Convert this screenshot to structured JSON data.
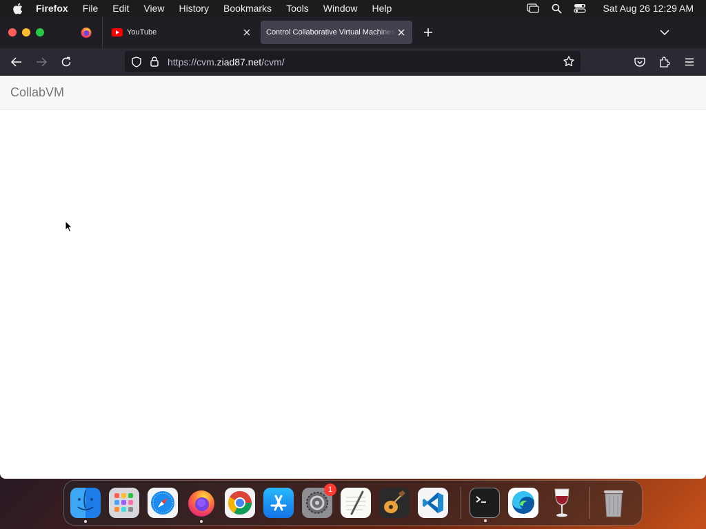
{
  "menubar": {
    "items": [
      "Firefox",
      "File",
      "Edit",
      "View",
      "History",
      "Bookmarks",
      "Tools",
      "Window",
      "Help"
    ],
    "clock": "Sat Aug 26  12:29 AM",
    "icons": [
      "apple-icon",
      "screen-mirroring-icon",
      "spotlight-search-icon",
      "control-center-icon"
    ]
  },
  "tabs": [
    {
      "title": "YouTube",
      "icon": "youtube-icon"
    },
    {
      "title": "Control Collaborative Virtual Machines!",
      "icon": "none",
      "active": true
    }
  ],
  "navbar": {
    "url_prefix": "https://cvm.",
    "url_host": "ziad87.net",
    "url_path": "/cvm/"
  },
  "page": {
    "brand": "CollabVM"
  },
  "dock": {
    "apps": [
      "Finder",
      "Launchpad",
      "Safari",
      "Firefox",
      "Google Chrome",
      "App Store",
      "System Settings",
      "TextEdit",
      "GarageBand",
      "Visual Studio Code",
      "Terminal",
      "Microsoft Edge",
      "Wine",
      "Trash"
    ],
    "settings_badge": "1"
  },
  "colors": {
    "tabstrip": "#1f1e25",
    "navbar": "#2b2a33",
    "urlbar": "#1c1b22",
    "active_tab": "#42414d",
    "site_header": "#f8f8f8"
  }
}
